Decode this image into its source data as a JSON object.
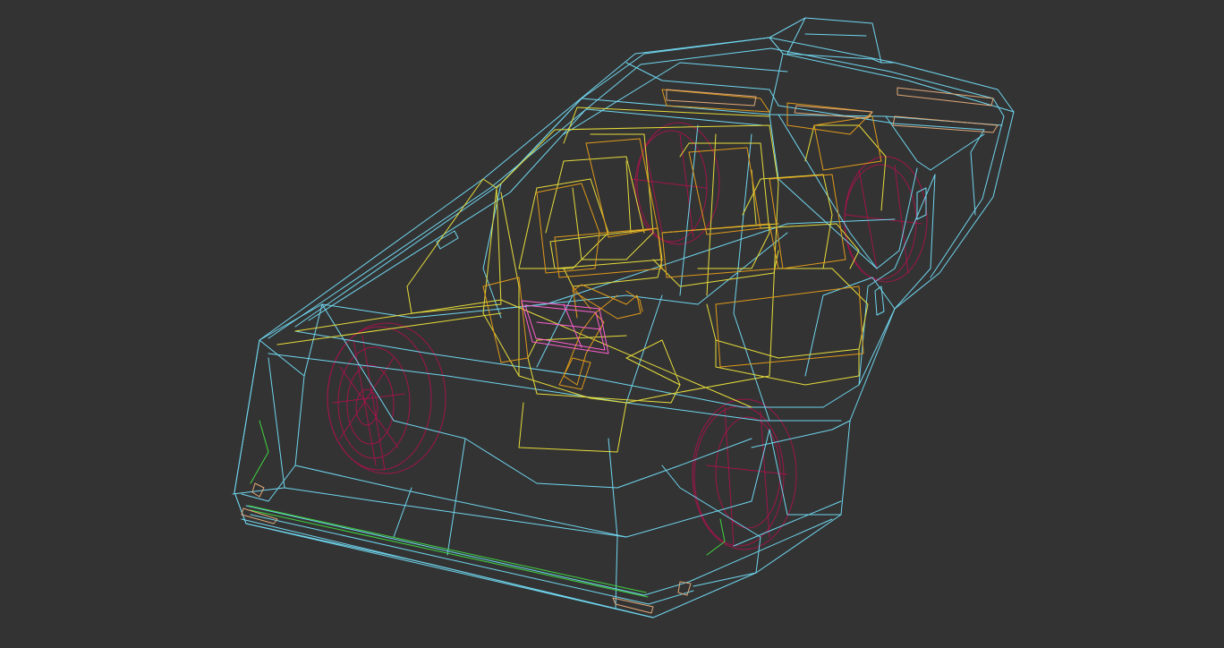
{
  "viewport": {
    "background": "#333333",
    "wireframe_colors": {
      "body_shell": "#6fd6ef",
      "interior": "#e6dc3a",
      "seats_and_details": "#e09a1a",
      "wheels": "#a0154a",
      "steering_wheel": "#ff5fd0",
      "trim": "#3fd43f",
      "lights": "#e0a878"
    }
  }
}
